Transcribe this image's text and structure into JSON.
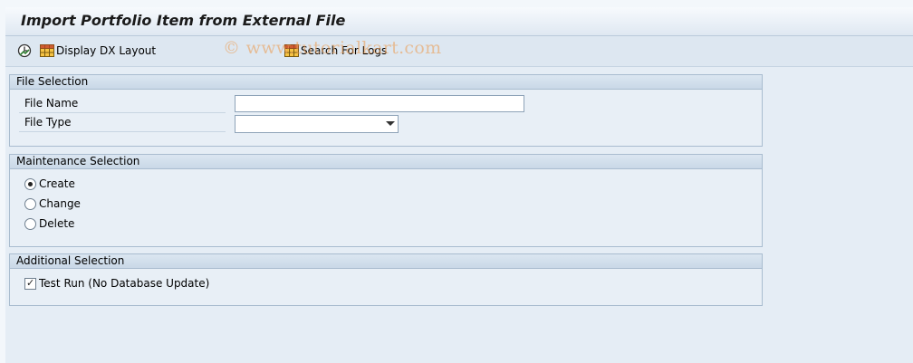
{
  "window": {
    "title": "Import Portfolio Item from External File"
  },
  "toolbar": {
    "display_dx_layout": "Display DX Layout",
    "search_for_logs": "Search For Logs"
  },
  "watermark": "© www.tutorialkart.com",
  "file_selection": {
    "header": "File Selection",
    "file_name_label": "File Name",
    "file_name_value": "",
    "file_type_label": "File Type",
    "file_type_value": ""
  },
  "maintenance_selection": {
    "header": "Maintenance Selection",
    "options": [
      {
        "label": "Create",
        "selected": true
      },
      {
        "label": "Change",
        "selected": false
      },
      {
        "label": "Delete",
        "selected": false
      }
    ]
  },
  "additional_selection": {
    "header": "Additional Selection",
    "test_run_label": "Test Run (No Database Update)",
    "test_run_checked": true
  },
  "colors": {
    "background": "#e5edf5",
    "group_header": "#c9d8e7",
    "border": "#a9bccf"
  }
}
